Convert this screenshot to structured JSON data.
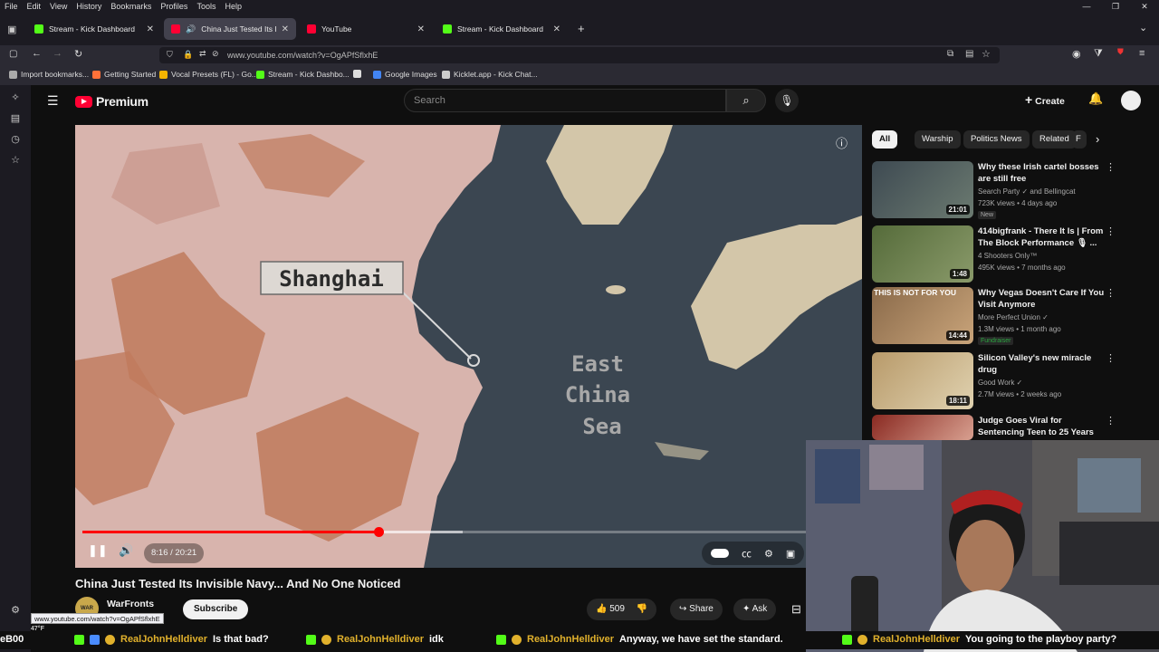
{
  "menu": [
    "File",
    "Edit",
    "View",
    "History",
    "Bookmarks",
    "Profiles",
    "Tools",
    "Help"
  ],
  "tabs": [
    {
      "title": "Stream - Kick Dashboard",
      "favicon_color": "#53fc18",
      "active": false
    },
    {
      "title": "China Just Tested Its Invisib",
      "favicon_color": "#ff0033",
      "active": true
    },
    {
      "title": "YouTube",
      "favicon_color": "#ff0033",
      "active": false
    },
    {
      "title": "Stream - Kick Dashboard",
      "favicon_color": "#53fc18",
      "active": false
    }
  ],
  "url": "www.youtube.com/watch?v=OgAPfSflxhE",
  "bookmarks": [
    {
      "label": "Import bookmarks...",
      "color": "#aaaaaa"
    },
    {
      "label": "Getting Started",
      "color": "#ff7139"
    },
    {
      "label": "Vocal Presets (FL) - Go...",
      "color": "#f4b400"
    },
    {
      "label": "Stream - Kick Dashbo...",
      "color": "#53fc18"
    },
    {
      "label": "Google Images",
      "color": "#4285f4"
    },
    {
      "label": "Kicklet.app - Kick Chat...",
      "color": "#cccccc"
    }
  ],
  "youtube": {
    "logo_text": "Premium",
    "search_placeholder": "Search",
    "create_label": "Create",
    "chips": [
      "All",
      "Warship",
      "Politics News",
      "Related",
      "F"
    ],
    "player": {
      "map_labels": {
        "city": "Shanghai",
        "sea_line1": "East",
        "sea_line2": "China",
        "sea_line3": "Sea"
      },
      "time": "8:16 / 20:21",
      "progress_fraction": 0.406
    },
    "video": {
      "title": "China Just Tested Its Invisible Navy... And No One Noticed",
      "channel": "WarFronts",
      "channel_avatar_text": "WAR",
      "subscribe": "Subscribe",
      "likes": "509",
      "share": "Share",
      "ask": "Ask"
    },
    "recommendations": [
      {
        "title": "Why these Irish cartel bosses are still free",
        "channel": "Search Party ✓ and Bellingcat",
        "meta": "723K views • 4 days ago",
        "duration": "21:01",
        "badge": "New",
        "thumb": "#4a5a62"
      },
      {
        "title": "414bigfrank - There It Is | From The Block Performance 🎙 ...",
        "channel": "4 Shooters Only™",
        "meta": "495K views • 7 months ago",
        "duration": "1:48",
        "badge": "",
        "thumb": "#6a7d4a"
      },
      {
        "title": "Why Vegas Doesn't Care If You Visit Anymore",
        "channel": "More Perfect Union ✓",
        "meta": "1.3M views • 1 month ago",
        "duration": "14:44",
        "badge": "Fundraiser",
        "thumb": "#9a7a5a",
        "thumb_text": "THIS IS NOT FOR YOU"
      },
      {
        "title": "Silicon Valley's new miracle drug",
        "channel": "Good Work ✓",
        "meta": "2.7M views • 2 weeks ago",
        "duration": "18:11",
        "badge": "",
        "thumb": "#c9b38a"
      },
      {
        "title": "Judge Goes Viral for Sentencing Teen to 25 Years Over ...",
        "channel": "",
        "meta": "",
        "duration": "",
        "badge": "",
        "thumb": "#b0473a"
      }
    ]
  },
  "status_url": "www.youtube.com/watch?v=OgAPfSflxhE",
  "ticker": [
    {
      "user": "RealJohnHelldiver",
      "msg": "Is that bad?"
    },
    {
      "user": "RealJohnHelldiver",
      "msg": "idk"
    },
    {
      "user": "RealJohnHelldiver",
      "msg": "Anyway, we have set the standard."
    },
    {
      "user": "RealJohnHelldiver",
      "msg": "You going to the playboy party?"
    }
  ],
  "ticker_lead": "eB00",
  "weather": "47°F"
}
